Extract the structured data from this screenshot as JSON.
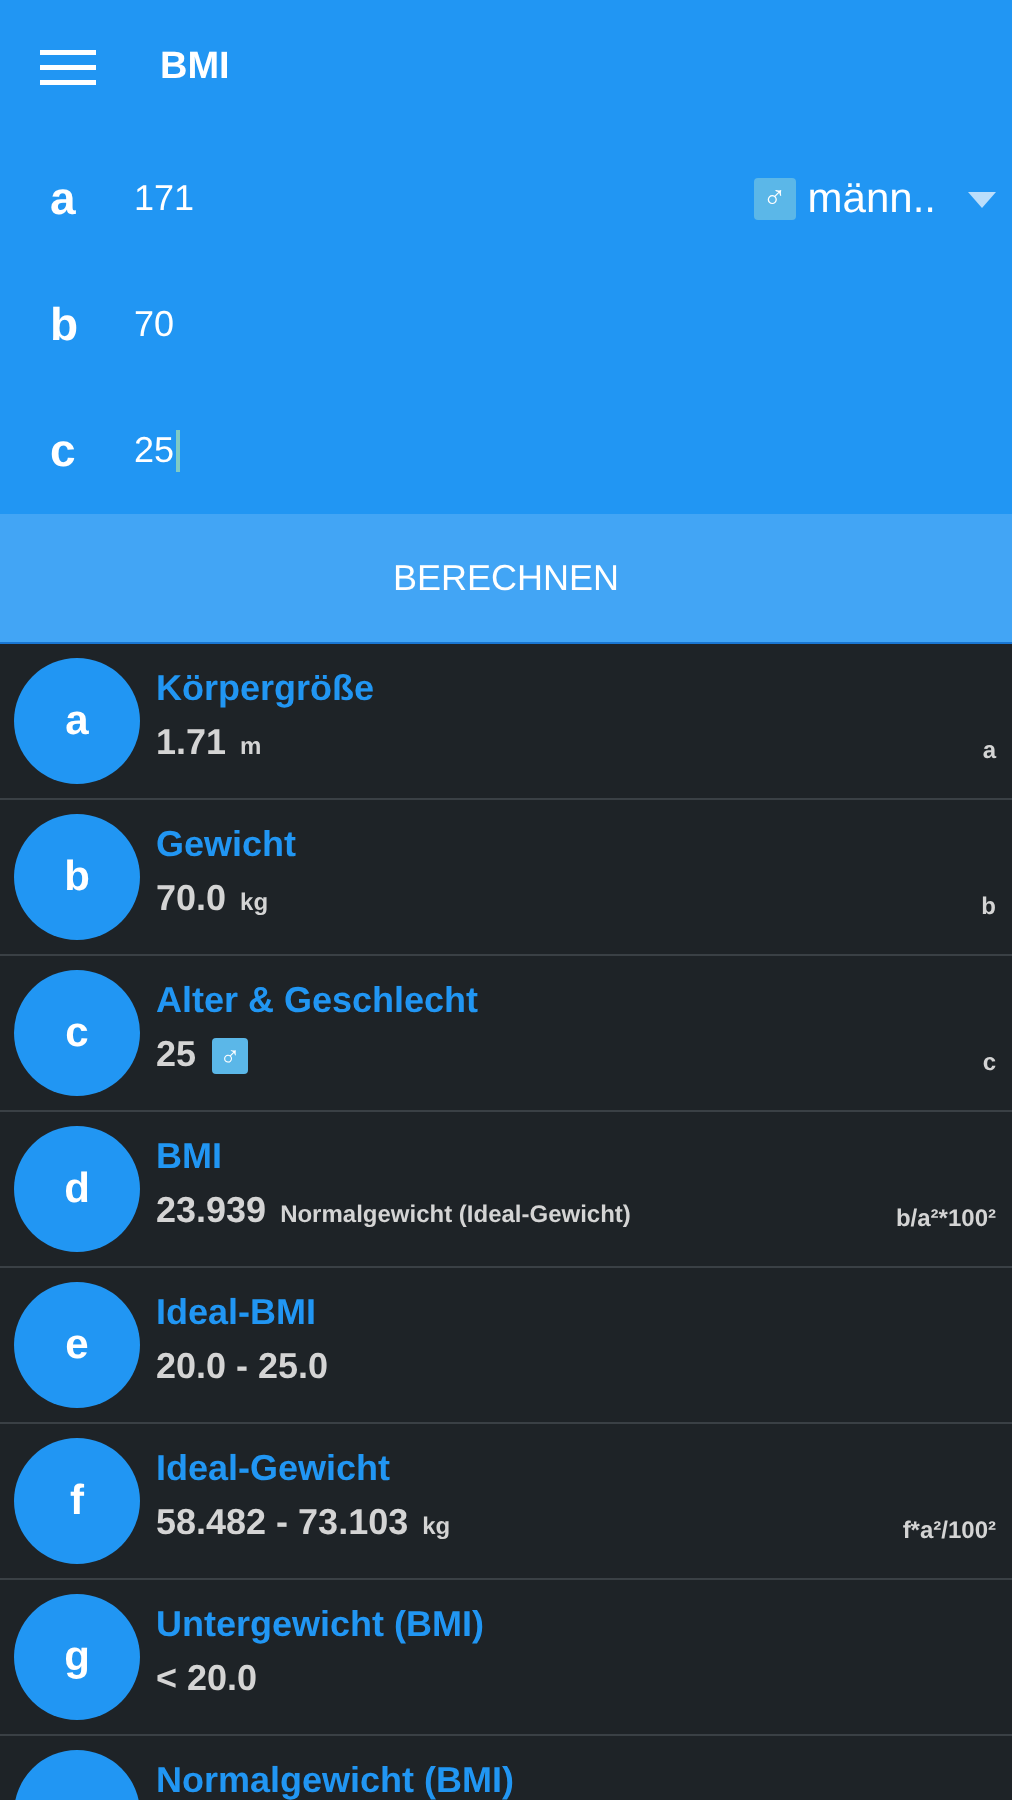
{
  "app_bar": {
    "title": "BMI"
  },
  "inputs": [
    {
      "label": "a",
      "value": "171",
      "focused": false
    },
    {
      "label": "b",
      "value": "70",
      "focused": false
    },
    {
      "label": "c",
      "value": "25",
      "focused": true
    }
  ],
  "gender_select": {
    "icon": "♂",
    "value": "männ.."
  },
  "calculate_button": "BERECHNEN",
  "results": [
    {
      "letter": "a",
      "title": "Körpergröße",
      "value": "1.71",
      "unit": "m",
      "formula": "a"
    },
    {
      "letter": "b",
      "title": "Gewicht",
      "value": "70.0",
      "unit": "kg",
      "formula": "b"
    },
    {
      "letter": "c",
      "title": "Alter & Geschlecht",
      "value": "25",
      "icon": "♂",
      "formula": "c"
    },
    {
      "letter": "d",
      "title": "BMI",
      "value": "23.939",
      "note": "Normalgewicht (Ideal-Gewicht)",
      "formula": "b/a²*100²"
    },
    {
      "letter": "e",
      "title": "Ideal-BMI",
      "value": "20.0 - 25.0"
    },
    {
      "letter": "f",
      "title": "Ideal-Gewicht",
      "value": "58.482 - 73.103",
      "unit": "kg",
      "formula": "f*a²/100²"
    },
    {
      "letter": "g",
      "title": "Untergewicht (BMI)",
      "value": "< 20.0"
    },
    {
      "title": "Normalgewicht (BMI)"
    }
  ]
}
